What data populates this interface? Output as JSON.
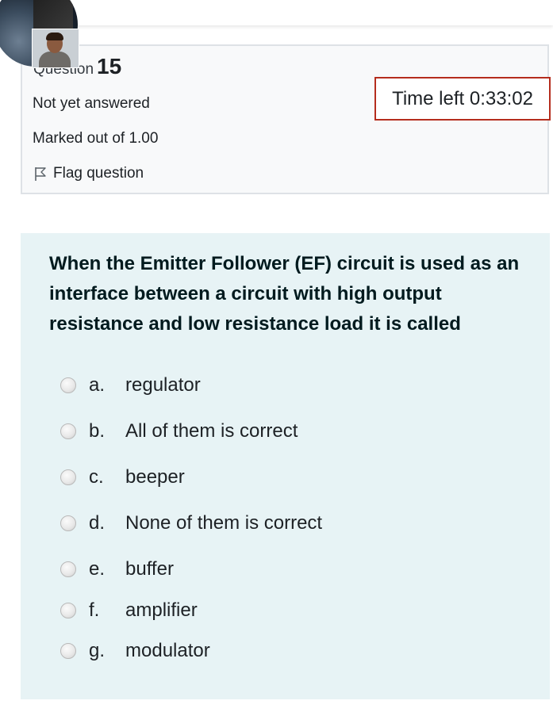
{
  "question": {
    "label": "Question",
    "number": "15",
    "state": "Not yet answered",
    "marks": "Marked out of 1.00",
    "flag_label": "Flag question"
  },
  "timer": {
    "text": "Time left 0:33:02"
  },
  "text": "When the Emitter Follower (EF) circuit is used as an interface between a circuit with high output resistance and low resistance load it is called",
  "options": [
    {
      "letter": "a.",
      "label": "regulator"
    },
    {
      "letter": "b.",
      "label": "All of them is correct"
    },
    {
      "letter": "c.",
      "label": "beeper"
    },
    {
      "letter": "d.",
      "label": "None of them is correct"
    },
    {
      "letter": "e.",
      "label": "buffer"
    },
    {
      "letter": "f.",
      "label": "amplifier"
    },
    {
      "letter": "g.",
      "label": "modulator"
    }
  ],
  "colors": {
    "timer_border": "#b52d1d",
    "formulation_bg": "#e7f3f5",
    "info_bg": "#f8f9fa"
  },
  "icons": {
    "flag": "flag-icon",
    "avatar": "user-avatar"
  }
}
